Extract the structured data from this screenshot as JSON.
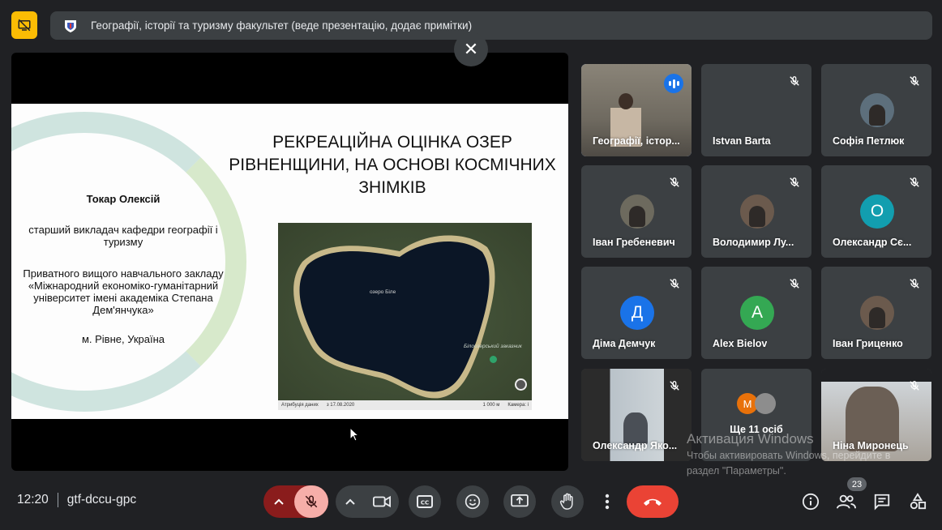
{
  "banner": {
    "text": "Географії, історії та туризму факультет (веде презентацію, додає примітки)"
  },
  "slide": {
    "title": "РЕКРЕАЦІЙНА ОЦІНКА ОЗЕР РІВНЕНЩИНИ, НА ОСНОВІ КОСМІЧНИХ ЗНІМКІВ",
    "author": "Токар Олексій",
    "position": "старший викладач кафедри географії і туризму",
    "institution": "Приватного вищого навчального закладу «Міжнародний економіко-гуманітарний університет імені академіка Степана Дем'янчука»",
    "city": "м. Рівне, Україна",
    "map": {
      "lake_label": "озеро Біле",
      "reserve_label": "Білоозерський заказник",
      "footer_left": "Атрибуція даних",
      "footer_date": "з 17.08.2020",
      "footer_scale": "1 000 м",
      "footer_right": "Камера: і"
    }
  },
  "participants": [
    {
      "name": "Географії, істор...",
      "status": "speaking",
      "kind": "video"
    },
    {
      "name": "Istvan Barta",
      "status": "muted",
      "kind": "blank"
    },
    {
      "name": "Софія Петлюк",
      "status": "muted",
      "kind": "photo"
    },
    {
      "name": "Іван Гребеневич",
      "status": "muted",
      "kind": "photo"
    },
    {
      "name": "Володимир Лу...",
      "status": "muted",
      "kind": "photo"
    },
    {
      "name": "Олександр Сє...",
      "status": "muted",
      "kind": "letter",
      "letter": "О",
      "color": "#129eaf"
    },
    {
      "name": "Діма Демчук",
      "status": "muted",
      "kind": "letter",
      "letter": "Д",
      "color": "#1a73e8"
    },
    {
      "name": "Alex Bielov",
      "status": "muted",
      "kind": "letter",
      "letter": "А",
      "color": "#34a853"
    },
    {
      "name": "Іван Гриценко",
      "status": "muted",
      "kind": "photo"
    },
    {
      "name": "Олександр Яко...",
      "status": "muted",
      "kind": "video"
    },
    {
      "name": "Ще 11 осіб",
      "status": "none",
      "kind": "more",
      "letter": "M",
      "color": "#e8710a"
    },
    {
      "name": "Ніна Миронець",
      "status": "muted",
      "kind": "video"
    }
  ],
  "windows_watermark": {
    "title": "Активация Windows",
    "line1": "Чтобы активировать Windows, перейдите в",
    "line2": "раздел \"Параметры\"."
  },
  "meeting": {
    "time": "12:20",
    "code": "gtf-dccu-gpc",
    "participant_count": "23"
  },
  "colors": {
    "background": "#202124",
    "tile": "#3c4043",
    "end_call": "#ea4335",
    "mic_off": "#f6aea9",
    "present_icon": "#fbbc04",
    "active_outline": "#8ab4f8"
  }
}
